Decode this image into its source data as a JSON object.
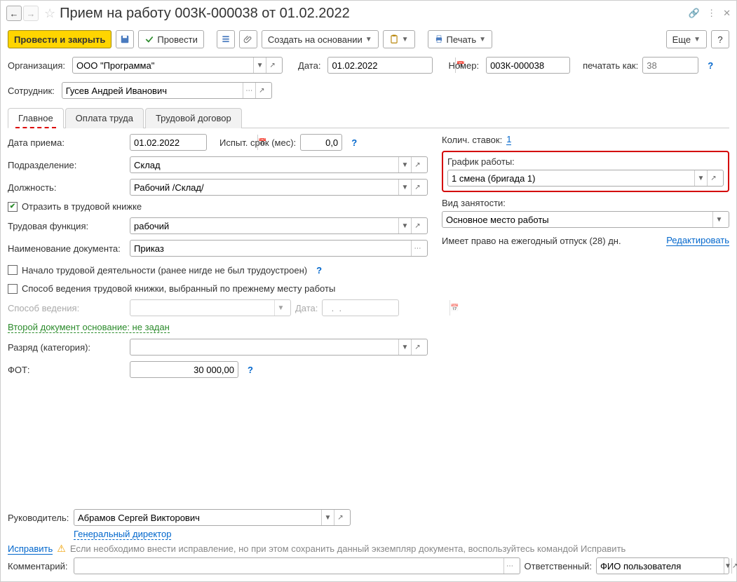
{
  "title": "Прием на работу 003К-000038 от 01.02.2022",
  "toolbar": {
    "post_close": "Провести и закрыть",
    "post": "Провести",
    "create_based": "Создать на основании",
    "print": "Печать",
    "more": "Еще"
  },
  "filters": {
    "org_lbl": "Организация:",
    "org_val": "ООО \"Программа\"",
    "date_lbl": "Дата:",
    "date_val": "01.02.2022",
    "num_lbl": "Номер:",
    "num_val": "003К-000038",
    "print_as_lbl": "печатать как:",
    "print_as_ph": "38",
    "emp_lbl": "Сотрудник:",
    "emp_val": "Гусев Андрей Иванович"
  },
  "tabs": {
    "main": "Главное",
    "pay": "Оплата труда",
    "contract": "Трудовой договор"
  },
  "main": {
    "hire_date_lbl": "Дата приема:",
    "hire_date_val": "01.02.2022",
    "probation_lbl": "Испыт. срок (мес):",
    "probation_val": "0,0",
    "dept_lbl": "Подразделение:",
    "dept_val": "Склад",
    "pos_lbl": "Должность:",
    "pos_val": "Рабочий /Склад/",
    "reflect_chk": "Отразить в трудовой книжке",
    "func_lbl": "Трудовая функция:",
    "func_val": "рабочий",
    "docname_lbl": "Наименование документа:",
    "docname_val": "Приказ",
    "start_chk": "Начало трудовой деятельности (ранее нигде не был трудоустроен)",
    "method_chk": "Способ ведения трудовой книжки, выбранный по прежнему месту работы",
    "method_lbl": "Способ ведения:",
    "method_date_lbl": "Дата:",
    "method_date_val": "  .  .    ",
    "second_doc": "Второй документ основание: не задан",
    "grade_lbl": "Разряд (категория):",
    "fot_lbl": "ФОТ:",
    "fot_val": "30 000,00"
  },
  "right": {
    "rates_lbl": "Колич. ставок:",
    "rates_val": "1",
    "sched_lbl": "График работы:",
    "sched_val": "1 смена (бригада 1)",
    "emptype_lbl": "Вид занятости:",
    "emptype_val": "Основное место работы",
    "vacation": "Имеет право на ежегодный отпуск (28) дн.",
    "edit": "Редактировать"
  },
  "footer": {
    "head_lbl": "Руководитель:",
    "head_val": "Абрамов Сергей Викторович",
    "head_role": "Генеральный директор",
    "fix": "Исправить",
    "fix_note": "Если необходимо внести исправление, но при этом сохранить данный экземпляр документа, воспользуйтесь командой Исправить",
    "comment_lbl": "Комментарий:",
    "resp_lbl": "Ответственный:",
    "resp_val": "ФИО пользователя"
  }
}
